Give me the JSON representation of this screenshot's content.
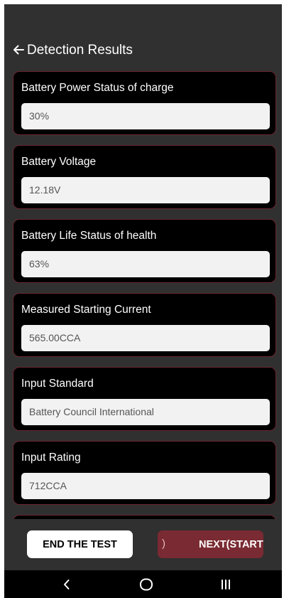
{
  "header": {
    "title": "Detection Results"
  },
  "cards": [
    {
      "label": "Battery Power Status of charge",
      "value": "30%"
    },
    {
      "label": "Battery Voltage",
      "value": "12.18V"
    },
    {
      "label": "Battery Life Status of health",
      "value": "63%"
    },
    {
      "label": "Measured Starting Current",
      "value": "565.00CCA"
    },
    {
      "label": "Input Standard",
      "value": "Battery Council International"
    },
    {
      "label": "Input Rating",
      "value": "712CCA"
    },
    {
      "label": "",
      "value": ""
    }
  ],
  "actions": {
    "end_label": "END THE TEST",
    "next_prefix": ")",
    "next_label": "NEXT(START"
  },
  "colors": {
    "background": "#303030",
    "card": "#000000",
    "card_border": "#6b2530",
    "field": "#f2f2f2",
    "accent": "#7a2a32"
  },
  "icons": {
    "back": "arrow-left-icon",
    "nav_back": "chevron-left-icon",
    "nav_home": "home-icon",
    "nav_recents": "recent-apps-icon"
  }
}
